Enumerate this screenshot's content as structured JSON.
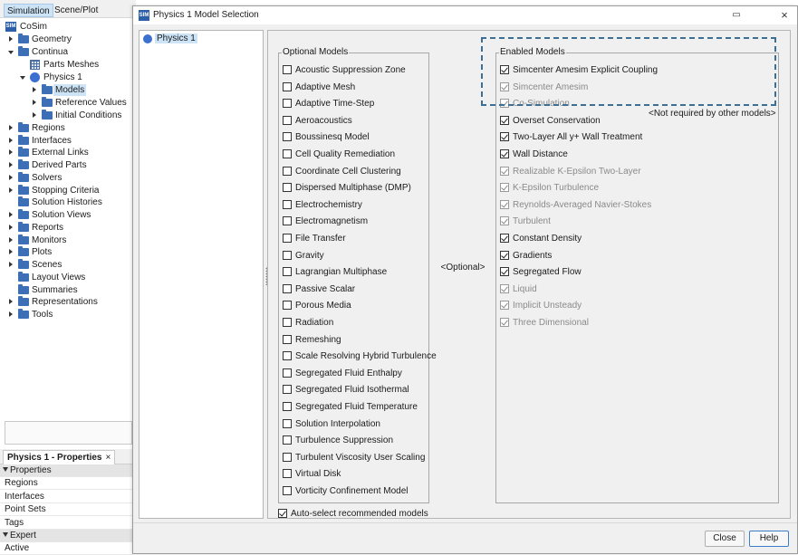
{
  "app": {
    "tabs": [
      "Simulation",
      "Scene/Plot"
    ],
    "tree": {
      "root": "CoSim",
      "geometry": "Geometry",
      "continua": "Continua",
      "parts_meshes": "Parts Meshes",
      "physics": "Physics 1",
      "models": "Models",
      "reference_values": "Reference Values",
      "initial_conditions": "Initial Conditions",
      "regions": "Regions",
      "interfaces": "Interfaces",
      "external_links": "External Links",
      "derived_parts": "Derived Parts",
      "solvers": "Solvers",
      "stopping_criteria": "Stopping Criteria",
      "solution_histories": "Solution Histories",
      "solution_views": "Solution Views",
      "reports": "Reports",
      "monitors": "Monitors",
      "plots": "Plots",
      "scenes": "Scenes",
      "layout_views": "Layout Views",
      "summaries": "Summaries",
      "representations": "Representations",
      "tools": "Tools"
    },
    "properties": {
      "tab_label": "Physics 1 - Properties",
      "close_glyph": "×",
      "section_properties": "Properties",
      "rows": [
        "Regions",
        "Interfaces",
        "Point Sets",
        "Tags"
      ],
      "section_expert": "Expert",
      "row_active": "Active"
    }
  },
  "dialog": {
    "title": "Physics 1 Model Selection",
    "restore_glyph": "▭",
    "close_glyph": "×",
    "physics_item": "Physics 1",
    "optional_models": {
      "title": "Optional Models",
      "items": [
        "Acoustic Suppression Zone",
        "Adaptive Mesh",
        "Adaptive Time-Step",
        "Aeroacoustics",
        "Boussinesq Model",
        "Cell Quality Remediation",
        "Coordinate Cell Clustering",
        "Dispersed Multiphase (DMP)",
        "Electrochemistry",
        "Electromagnetism",
        "File Transfer",
        "Gravity",
        "Lagrangian Multiphase",
        "Passive Scalar",
        "Porous Media",
        "Radiation",
        "Remeshing",
        "Scale Resolving Hybrid Turbulence",
        "Segregated Fluid Enthalpy",
        "Segregated Fluid Isothermal",
        "Segregated Fluid Temperature",
        "Solution Interpolation",
        "Turbulence Suppression",
        "Turbulent Viscosity User Scaling",
        "Virtual Disk",
        "Vorticity Confinement Model"
      ]
    },
    "optional_center_label": "<Optional>",
    "enabled_models": {
      "title": "Enabled Models",
      "not_required_label": "<Not required by other models>",
      "items": [
        {
          "label": "Simcenter Amesim Explicit Coupling",
          "checked": true,
          "disabled": false
        },
        {
          "label": "Simcenter Amesim",
          "checked": true,
          "disabled": true
        },
        {
          "label": "Co-Simulation",
          "checked": true,
          "disabled": true
        },
        {
          "label": "Overset Conservation",
          "checked": true,
          "disabled": false
        },
        {
          "label": "Two-Layer All y+ Wall Treatment",
          "checked": true,
          "disabled": false
        },
        {
          "label": "Wall Distance",
          "checked": true,
          "disabled": false
        },
        {
          "label": "Realizable K-Epsilon Two-Layer",
          "checked": true,
          "disabled": true
        },
        {
          "label": "K-Epsilon Turbulence",
          "checked": true,
          "disabled": true
        },
        {
          "label": "Reynolds-Averaged Navier-Stokes",
          "checked": true,
          "disabled": true
        },
        {
          "label": "Turbulent",
          "checked": true,
          "disabled": true
        },
        {
          "label": "Constant Density",
          "checked": true,
          "disabled": false
        },
        {
          "label": "Gradients",
          "checked": true,
          "disabled": false
        },
        {
          "label": "Segregated Flow",
          "checked": true,
          "disabled": false
        },
        {
          "label": "Liquid",
          "checked": true,
          "disabled": true
        },
        {
          "label": "Implicit Unsteady",
          "checked": true,
          "disabled": true
        },
        {
          "label": "Three Dimensional",
          "checked": true,
          "disabled": true
        }
      ]
    },
    "auto_select": {
      "label": "Auto-select recommended models",
      "checked": true
    },
    "buttons": {
      "close": "Close",
      "help": "Help"
    }
  },
  "colors": {
    "selection": "#cde4f7",
    "folder_icon": "#3d6fb6",
    "physics_dot": "#3b6fd0",
    "dashed_frame": "#3c6f95",
    "disabled_text": "#8a8a8a"
  }
}
